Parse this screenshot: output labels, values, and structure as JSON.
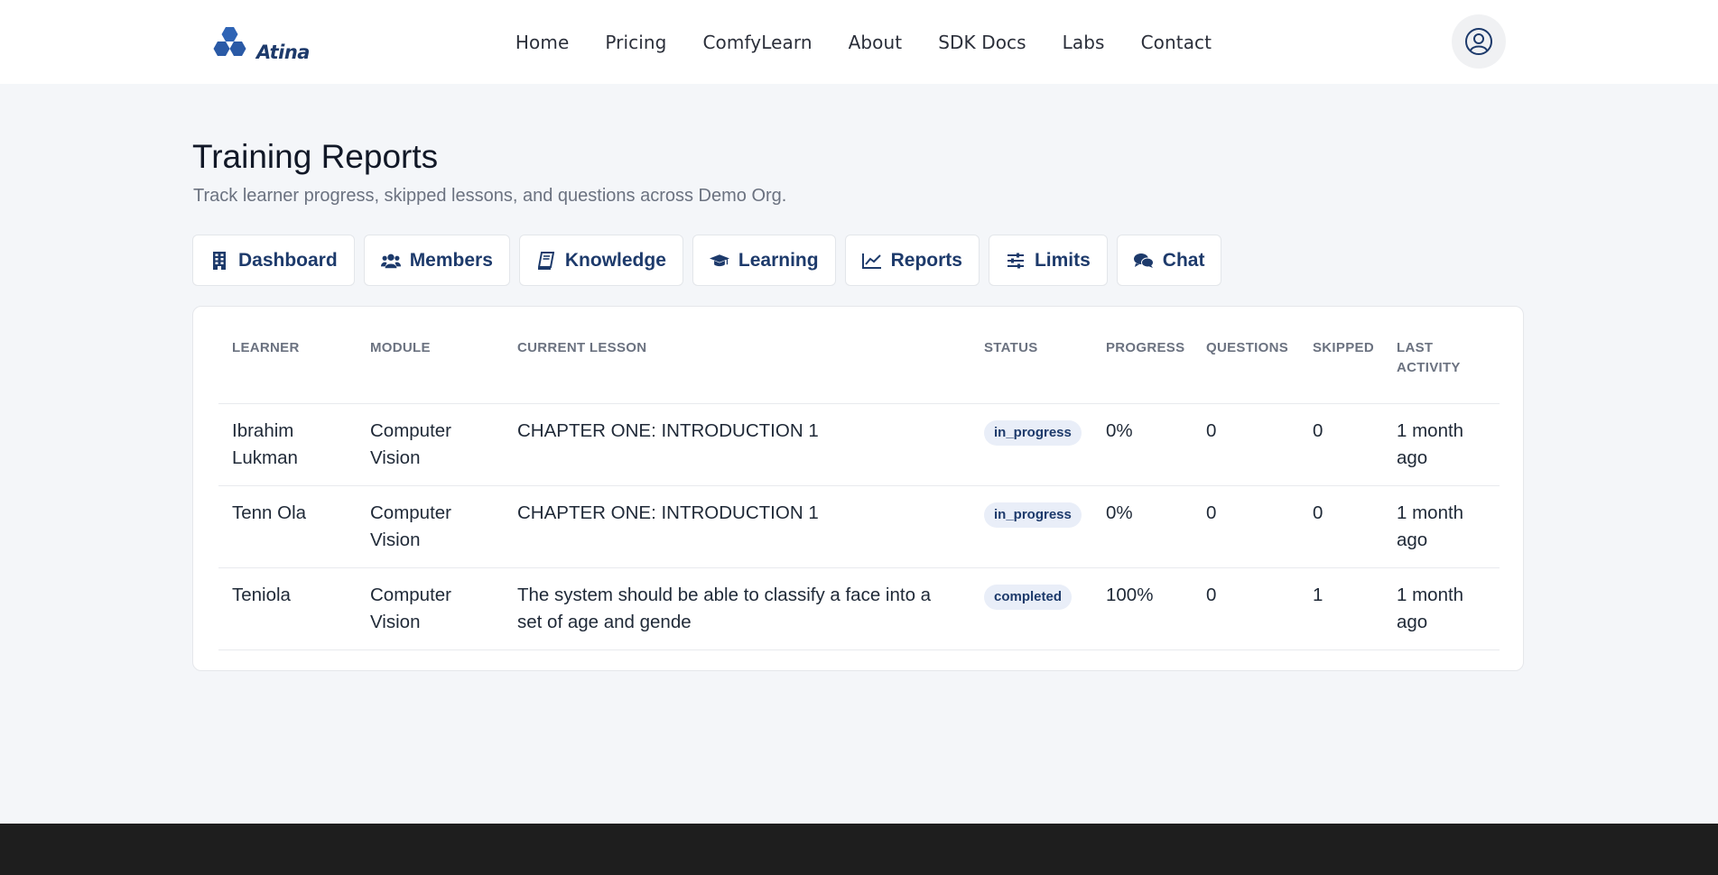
{
  "brand": {
    "name": "Atina"
  },
  "nav": {
    "items": [
      "Home",
      "Pricing",
      "ComfyLearn",
      "About",
      "SDK Docs",
      "Labs",
      "Contact"
    ]
  },
  "user_menu": {
    "icon": "user-circle-icon"
  },
  "page": {
    "title": "Training Reports",
    "subtitle": "Track learner progress, skipped lessons, and questions across Demo Org."
  },
  "tabs": [
    {
      "label": "Dashboard",
      "icon": "building-icon"
    },
    {
      "label": "Members",
      "icon": "users-icon"
    },
    {
      "label": "Knowledge",
      "icon": "book-icon"
    },
    {
      "label": "Learning",
      "icon": "graduation-cap-icon"
    },
    {
      "label": "Reports",
      "icon": "line-chart-icon"
    },
    {
      "label": "Limits",
      "icon": "sliders-icon"
    },
    {
      "label": "Chat",
      "icon": "comments-icon"
    }
  ],
  "table": {
    "headers": [
      "LEARNER",
      "MODULE",
      "CURRENT LESSON",
      "STATUS",
      "PROGRESS",
      "QUESTIONS",
      "SKIPPED",
      "LAST ACTIVITY"
    ],
    "rows": [
      [
        "Ibrahim Lukman",
        "Computer Vision",
        "CHAPTER ONE: INTRODUCTION 1",
        "in_progress",
        "0%",
        "0",
        "0",
        "1 month ago"
      ],
      [
        "Tenn Ola",
        "Computer Vision",
        "CHAPTER ONE: INTRODUCTION 1",
        "in_progress",
        "0%",
        "0",
        "0",
        "1 month ago"
      ],
      [
        "Teniola",
        "Computer Vision",
        "The system should be able to classify a face into a set of age and gende",
        "completed",
        "100%",
        "0",
        "1",
        "1 month ago"
      ]
    ]
  },
  "colors": {
    "accent": "#1d3a6b",
    "page_bg": "#f4f6f9",
    "badge_bg": "#e9eef8",
    "footer_bg": "#1e1e1e"
  }
}
